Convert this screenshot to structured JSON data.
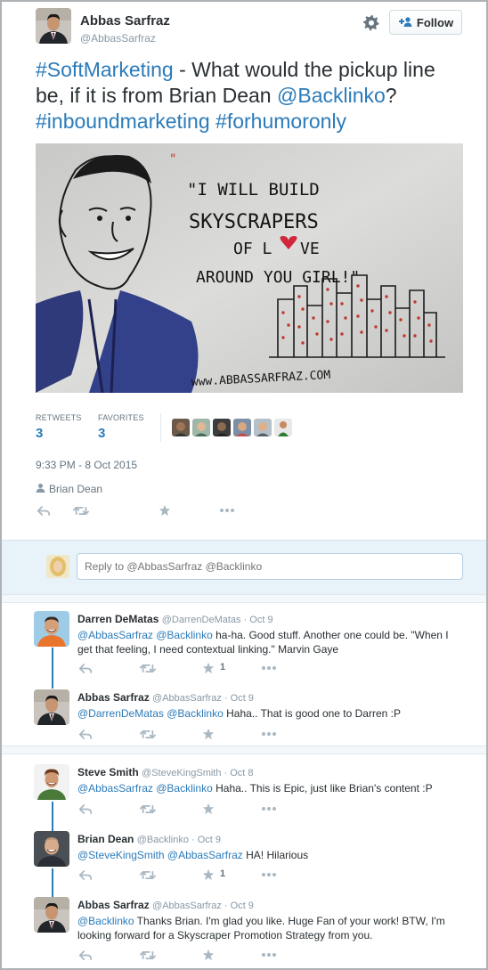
{
  "header": {
    "name": "Abbas Sarfraz",
    "handle": "@AbbasSarfraz",
    "follow_label": "Follow"
  },
  "tweet": {
    "parts": [
      {
        "text": "#SoftMarketing",
        "link": true
      },
      {
        "text": " - What would the pickup line be, if it is from Brian Dean  ",
        "link": false
      },
      {
        "text": "@Backlinko",
        "link": true
      },
      {
        "text": "? ",
        "link": false
      },
      {
        "text": "#inboundmarketing",
        "link": true
      },
      {
        "text": " ",
        "link": false
      },
      {
        "text": "#forhumoronly",
        "link": true
      }
    ]
  },
  "media": {
    "line1": "\"I WILL BUILD",
    "line2": "SKYSCRAPERS",
    "line3a": "OF L",
    "line3b": "VE",
    "line4": "AROUND YOU GIRL!\"",
    "watermark": "www.ABBASSARFRAZ.COM"
  },
  "stats": {
    "retweets_label": "RETWEETS",
    "retweets": "3",
    "favorites_label": "FAVORITES",
    "favorites": "3"
  },
  "timestamp": "9:33 PM - 8 Oct 2015",
  "via": "Brian Dean",
  "reply_box": {
    "placeholder": "Reply to @AbbasSarfraz @Backlinko"
  },
  "replies": [
    {
      "name": "Darren DeMatas",
      "meta": "@DarrenDeMatas · Oct 9",
      "links": "@AbbasSarfraz @Backlinko",
      "text": " ha-ha. Good stuff. Another one could be. \"When I get that feeling, I need contextual linking.\" Marvin Gaye",
      "fav_count": "1"
    },
    {
      "name": "Abbas Sarfraz",
      "meta": "@AbbasSarfraz · Oct 9",
      "links": "@DarrenDeMatas @Backlinko",
      "text": " Haha.. That is good one to Darren :P",
      "fav_count": ""
    },
    {
      "name": "Steve Smith",
      "meta": "@SteveKingSmith · Oct 8",
      "links": "@AbbasSarfraz @Backlinko",
      "text": " Haha.. This is Epic, just like Brian's content :P",
      "fav_count": ""
    },
    {
      "name": "Brian Dean",
      "meta": "@Backlinko · Oct 9",
      "links": "@SteveKingSmith @AbbasSarfraz",
      "text": " HA! Hilarious",
      "fav_count": "1"
    },
    {
      "name": "Abbas Sarfraz",
      "meta": "@AbbasSarfraz · Oct 9",
      "links": "@Backlinko",
      "text": " Thanks Brian. I'm glad you like. Huge Fan of your work! BTW, I'm looking forward for a Skyscraper Promotion Strategy from you.",
      "fav_count": ""
    }
  ]
}
